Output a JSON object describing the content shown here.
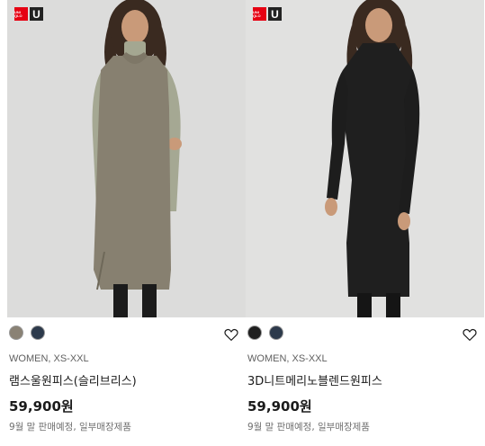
{
  "products": [
    {
      "logo": {
        "brand": "UNI QLO",
        "sub": "U"
      },
      "colors": [
        "#8a8275",
        "#2d3a4b"
      ],
      "category": "WOMEN, XS-XXL",
      "name": "램스울원피스(슬리브리스)",
      "price": "59,900원",
      "note": "9월 말 판매예정, 일부매장제품",
      "wishlist_icon": "heart-outline-icon"
    },
    {
      "logo": {
        "brand": "UNI QLO",
        "sub": "U"
      },
      "colors": [
        "#1f1f1f",
        "#2d3a4b"
      ],
      "category": "WOMEN, XS-XXL",
      "name": "3D니트메리노블렌드원피스",
      "price": "59,900원",
      "note": "9월 말 판매예정, 일부매장제품",
      "wishlist_icon": "heart-outline-icon"
    }
  ]
}
